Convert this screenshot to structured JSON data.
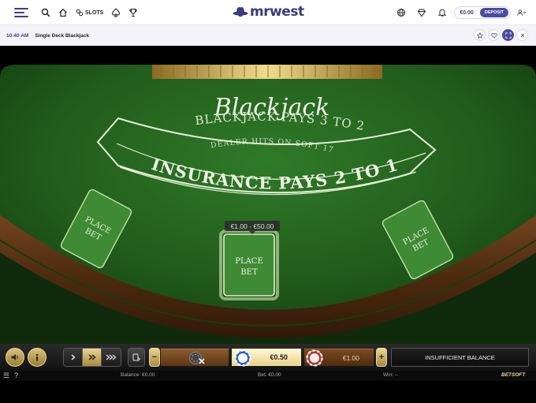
{
  "header": {
    "logo_text": "mrwest",
    "slots_label": "SLOTS",
    "balance_amount": "€0.00",
    "deposit_label": "DEPOSIT"
  },
  "subheader": {
    "time": "10:40 AM",
    "game_title": "Single Deck Blackjack"
  },
  "table": {
    "logo": "Blackjack",
    "payout_text": "BLACKJACK PAYS 3 TO 2",
    "dealer_rule": "DEALER HITS ON SOFT 17",
    "insurance_text": "INSURANCE PAYS 2 TO 1",
    "limits_tooltip": "€1.00 - €50.00",
    "place_bet_line1": "PLACE",
    "place_bet_line2": "BET"
  },
  "controls": {
    "chip_value": "€0.50",
    "total_bet_value": "€1.00",
    "status_message": "INSUFFICIENT BALANCE",
    "minus_label": "−",
    "plus_label": "+"
  },
  "statusbar": {
    "balance_text": "Balance: €0.00",
    "bet_text": "Bet: €0.00",
    "win_text": "Win: --",
    "provider_logo": "BETSOFT",
    "help_label": "?"
  },
  "colors": {
    "brand": "#3b3b8f",
    "felt": "#1f5a1a",
    "rail": "#5a3414",
    "gold": "#d9c27a"
  },
  "icons": [
    "menu-icon",
    "search-icon",
    "home-icon",
    "slots-icon",
    "spade-icon",
    "trophy-icon",
    "globe-icon",
    "diamond-icon",
    "bell-icon",
    "user-icon",
    "star-icon",
    "heart-icon",
    "expand-icon",
    "close-icon",
    "sound-icon",
    "info-icon",
    "deal-icon"
  ]
}
